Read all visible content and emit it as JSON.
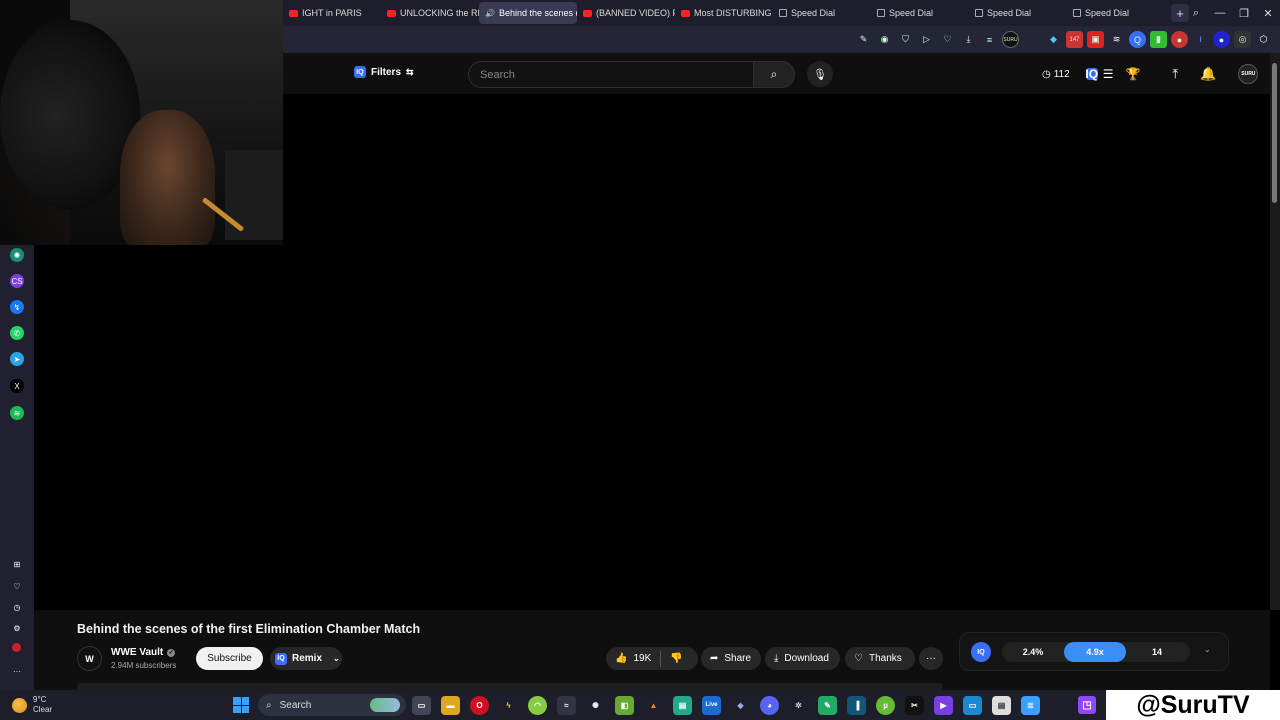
{
  "browser": {
    "tabs": [
      {
        "label": "IGHT in PARIS",
        "icon": "youtube-icon",
        "active": false
      },
      {
        "label": "UNLOCKING the REAL",
        "icon": "youtube-icon",
        "active": false
      },
      {
        "label": "Behind the scenes of",
        "icon": "audio-icon",
        "active": true
      },
      {
        "label": "(BANNED VIDEO) PRO",
        "icon": "youtube-icon",
        "active": false
      },
      {
        "label": "Most DISTURBING Ab",
        "icon": "youtube-icon",
        "active": false
      },
      {
        "label": "Speed Dial",
        "icon": "speed-dial-icon",
        "active": false
      },
      {
        "label": "Speed Dial",
        "icon": "speed-dial-icon",
        "active": false
      },
      {
        "label": "Speed Dial",
        "icon": "speed-dial-icon",
        "active": false
      },
      {
        "label": "Speed Dial",
        "icon": "speed-dial-icon",
        "active": false
      }
    ],
    "new_tab": "+",
    "badge_count": "147"
  },
  "youtube": {
    "filters_label": "Filters",
    "search_placeholder": "Search",
    "counter": "112",
    "avatar_text": "SURU"
  },
  "video": {
    "title": "Behind the scenes of the first Elimination Chamber Match",
    "channel": {
      "name": "WWE Vault",
      "subscribers": "2.94M subscribers",
      "logo_text": "W"
    },
    "subscribe_label": "Subscribe",
    "remix_label": "Remix",
    "likes": "19K",
    "share_label": "Share",
    "download_label": "Download",
    "thanks_label": "Thanks",
    "more_label": "···"
  },
  "iq_stats": [
    "2.4%",
    "4.9x",
    "14"
  ],
  "taskbar": {
    "temperature": "9°C",
    "condition": "Clear",
    "search_label": "Search"
  },
  "watermark": "@SuruTV",
  "colors": {
    "accent_blue": "#3b8ef6",
    "twitch": "#9146ff",
    "youtube_red": "#ff2020"
  }
}
